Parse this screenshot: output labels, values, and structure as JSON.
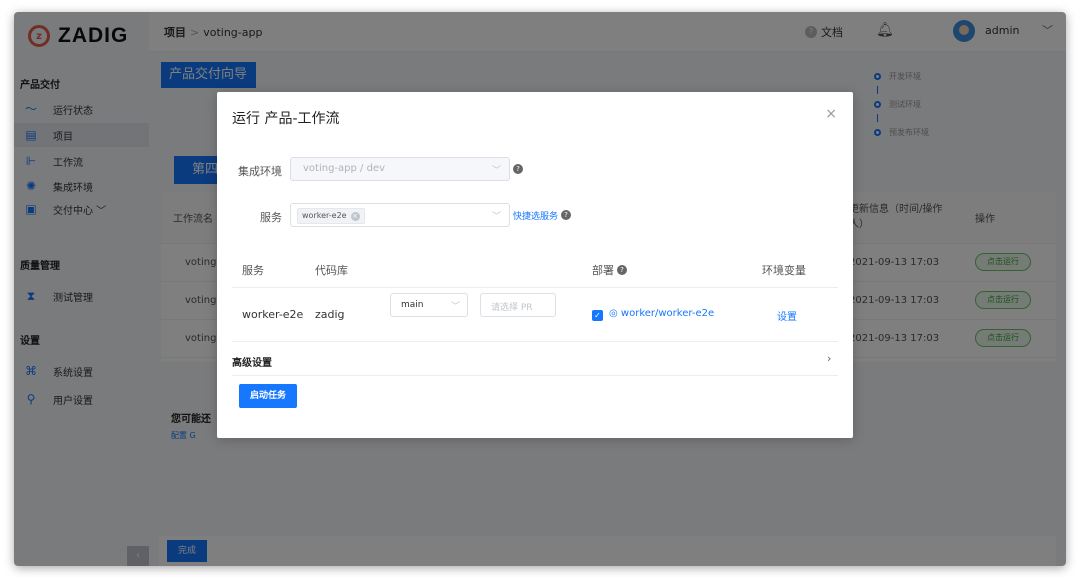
{
  "brand": {
    "name": "ZADIG"
  },
  "sidebar": {
    "section_delivery": "产品交付",
    "items": [
      {
        "label": "运行状态",
        "icon": "pulse-chart-icon"
      },
      {
        "label": "项目",
        "icon": "project-icon"
      },
      {
        "label": "工作流",
        "icon": "workflow-icon"
      },
      {
        "label": "集成环境",
        "icon": "environment-icon"
      },
      {
        "label": "交付中心 ﹀",
        "icon": "delivery-center-icon"
      }
    ],
    "section_quality": "质量管理",
    "quality_items": [
      {
        "label": "测试管理",
        "icon": "test-icon"
      }
    ],
    "section_settings": "设置",
    "settings_items": [
      {
        "label": "系统设置",
        "icon": "system-settings-icon"
      },
      {
        "label": "用户设置",
        "icon": "user-settings-icon"
      }
    ],
    "collapse_label": "‹"
  },
  "topbar": {
    "breadcrumb_root": "项目",
    "breadcrumb_sep": ">",
    "breadcrumb_current": "voting-app",
    "docs_label": "文档",
    "user_name": "admin"
  },
  "background": {
    "guide_label": "产品交付向导",
    "steps": [
      "开发环境",
      "测试环境",
      "预发布环境"
    ],
    "tab_label": "第四",
    "table_headers": {
      "name": "工作流名",
      "updated": "更新信息（时间/操作人）",
      "ops": "操作"
    },
    "rows": [
      {
        "name": "voting-",
        "updated": "2021-09-13 17:03",
        "action": "点击运行"
      },
      {
        "name": "voting-",
        "updated": "2021-09-13 17:03",
        "action": "点击运行"
      },
      {
        "name": "voting-",
        "updated": "2021-09-13 17:03",
        "action": "点击运行"
      }
    ],
    "hint_title": "您可能还",
    "hint_link": "配置 G",
    "done_label": "完成"
  },
  "modal": {
    "title": "运行 产品-工作流",
    "close_label": "×",
    "env_label": "集成环境",
    "env_value": "voting-app / dev",
    "service_label": "服务",
    "service_chip": "worker-e2e",
    "quick_select": "快捷选服务",
    "table_headers": {
      "service": "服务",
      "repo": "代码库",
      "deploy": "部署",
      "env_vars": "环境变量"
    },
    "row": {
      "service": "worker-e2e",
      "repo": "zadig",
      "branch": "main",
      "pr_placeholder": "请选择 PR",
      "deploy_target": "worker/worker-e2e",
      "env_action": "设置"
    },
    "advanced_label": "高级设置",
    "start_label": "启动任务"
  },
  "colors": {
    "accent": "#1677ff",
    "brand": "#e25c4a",
    "overlay": "rgba(0,0,0,0.5)"
  }
}
